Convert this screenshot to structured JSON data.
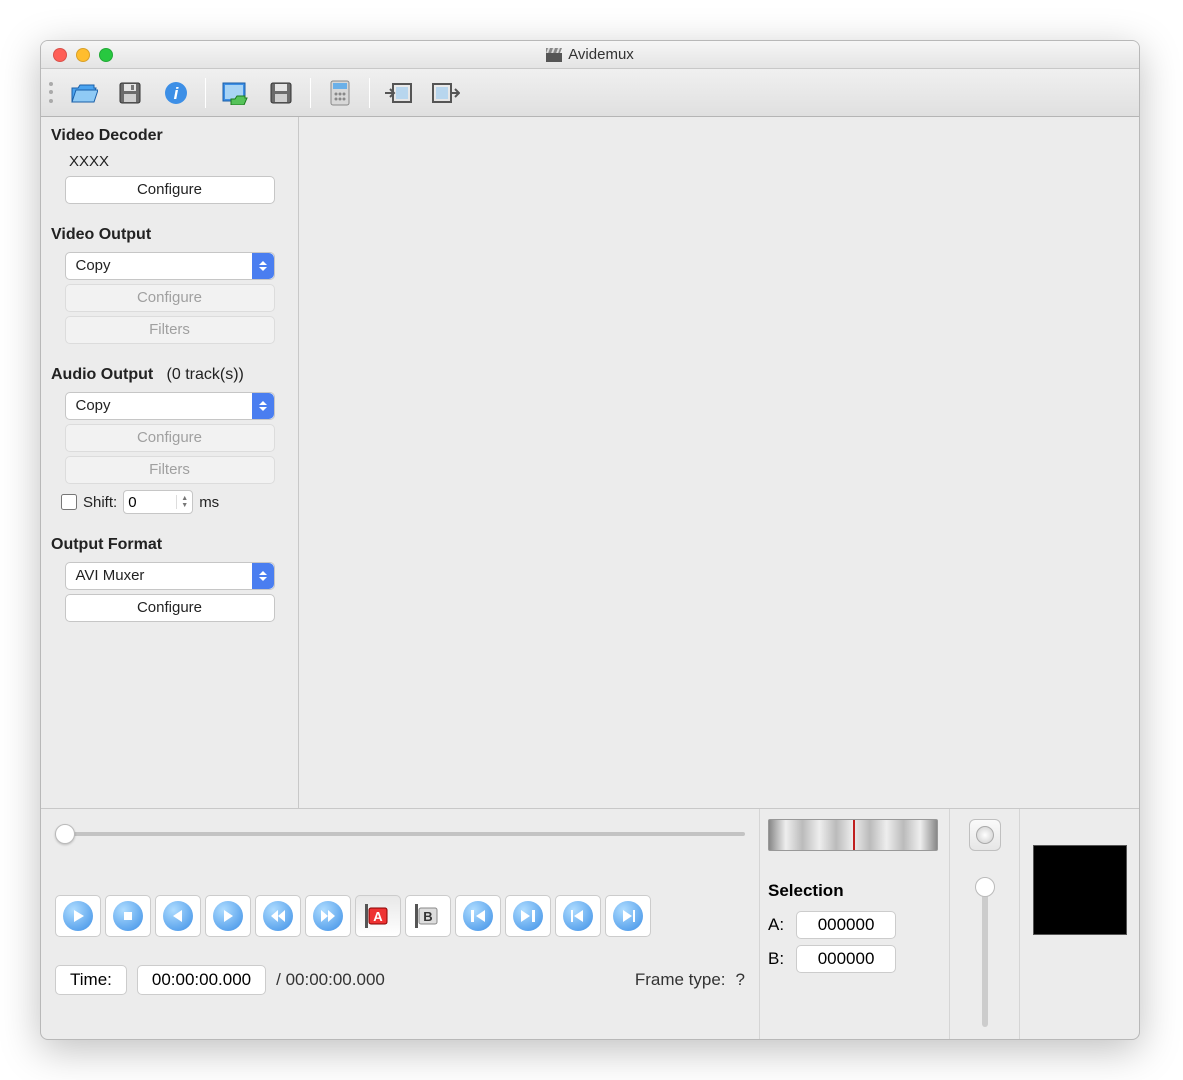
{
  "window": {
    "title": "Avidemux"
  },
  "sidebar": {
    "video_decoder": {
      "title": "Video Decoder",
      "codec": "XXXX",
      "configure": "Configure"
    },
    "video_output": {
      "title": "Video Output",
      "selected": "Copy",
      "configure": "Configure",
      "filters": "Filters"
    },
    "audio_output": {
      "title": "Audio Output",
      "tracks_suffix": "(0 track(s))",
      "selected": "Copy",
      "configure": "Configure",
      "filters": "Filters",
      "shift_label": "Shift:",
      "shift_value": "0",
      "shift_unit": "ms"
    },
    "output_format": {
      "title": "Output Format",
      "selected": "AVI Muxer",
      "configure": "Configure"
    }
  },
  "time": {
    "label": "Time:",
    "current": "00:00:00.000",
    "total_prefix": "/ 00:00:00.000",
    "frame_type_label": "Frame type:",
    "frame_type_value": "?"
  },
  "selection": {
    "title": "Selection",
    "a_label": "A:",
    "a_value": "000000",
    "b_label": "B:",
    "b_value": "000000"
  }
}
